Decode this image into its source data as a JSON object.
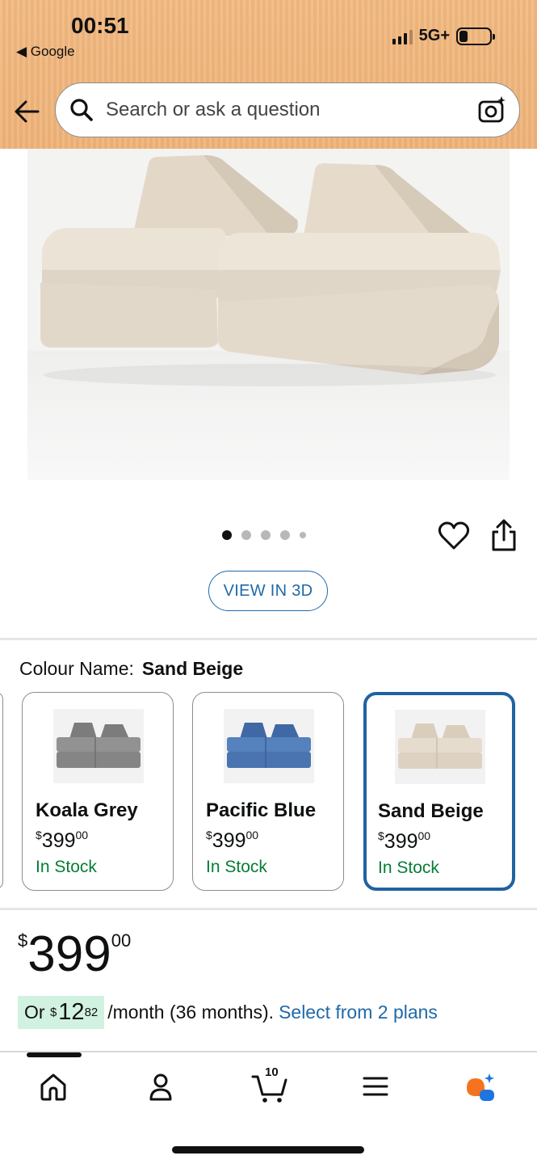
{
  "status_bar": {
    "time": "00:51",
    "back_app": "◀ Google",
    "network": "5G+",
    "battery_level": 0.2
  },
  "search": {
    "placeholder": "Search or ask a question"
  },
  "gallery": {
    "dots_total": 5,
    "active_dot": 1,
    "view_3d_label": "VIEW IN 3D"
  },
  "colour": {
    "label": "Colour Name:",
    "selected": "Sand Beige",
    "options": [
      {
        "name": "Koala Grey",
        "price_symbol": "$",
        "price_main": "399",
        "price_cents": "00",
        "stock": "In Stock",
        "swatch_color": "#8f8f8f",
        "selected": false
      },
      {
        "name": "Pacific Blue",
        "price_symbol": "$",
        "price_main": "399",
        "price_cents": "00",
        "stock": "In Stock",
        "swatch_color": "#4f79b3",
        "selected": false
      },
      {
        "name": "Sand Beige",
        "price_symbol": "$",
        "price_main": "399",
        "price_cents": "00",
        "stock": "In Stock",
        "swatch_color": "#dccfbe",
        "selected": true
      }
    ]
  },
  "price": {
    "symbol": "$",
    "main": "399",
    "cents": "00"
  },
  "monthly": {
    "prefix": "Or",
    "symbol": "$",
    "main": "12",
    "cents": "82",
    "suffix": "/month (36 months).",
    "link": "Select from 2 plans"
  },
  "bottom_nav": {
    "cart_count": "10",
    "items": [
      "home",
      "account",
      "cart",
      "menu",
      "rufus"
    ]
  },
  "colors": {
    "header": "#f0b47a",
    "link": "#1f69a9",
    "in_stock": "#067d34",
    "selected_border": "#2162a1",
    "monthly_highlight": "#d2f2e1"
  }
}
